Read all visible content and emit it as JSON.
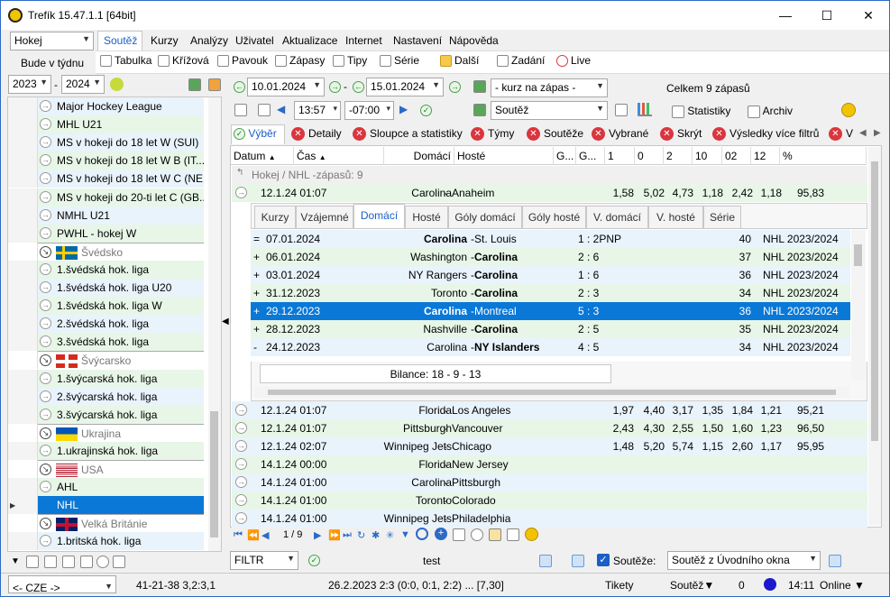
{
  "window": {
    "title": "Trefík 15.47.1.1 [64bit]"
  },
  "sport_select": "Hokej",
  "menu": [
    "Soutěž",
    "Kurzy",
    "Analýzy",
    "Uživatel",
    "Aktualizace",
    "Internet",
    "Nastavení",
    "Nápověda"
  ],
  "week_label": "Bude v týdnu",
  "toolbar": [
    "Tabulka",
    "Křížová",
    "Pavouk",
    "Zápasy",
    "Tipy",
    "Série",
    "Další",
    "Zadání",
    "Live"
  ],
  "year_from": "2023",
  "year_to": "2024",
  "date_from": "10.01.2024",
  "date_to": "15.01.2024",
  "time_from": "13:57",
  "time_to": "-07:00",
  "odds_select": "- kurz na zápas -",
  "competition_select": "Soutěž",
  "total_label": "Celkem 9 zápasů",
  "stats_label": "Statistiky",
  "archive_label": "Archiv",
  "tabs2": [
    "Výběr",
    "Detaily",
    "Sloupce a statistiky",
    "Týmy",
    "Soutěže",
    "Vybrané",
    "Skrýt",
    "Výsledky více filtrů",
    "V"
  ],
  "left_list": [
    {
      "label": "Major Hockey League",
      "type": "league"
    },
    {
      "label": "MHL U21",
      "type": "league"
    },
    {
      "label": "MS v hokeji do 18 let W (SUI)",
      "type": "league"
    },
    {
      "label": "MS v hokeji do 18 let W B (IT...",
      "type": "league"
    },
    {
      "label": "MS v hokeji do 18 let W C (NE...",
      "type": "league"
    },
    {
      "label": "MS v hokeji do 20-ti let C (GB...",
      "type": "league"
    },
    {
      "label": "NMHL U21",
      "type": "league"
    },
    {
      "label": "PWHL - hokej W",
      "type": "league"
    },
    {
      "label": "Švédsko",
      "type": "country",
      "flag": "se"
    },
    {
      "label": "1.švédská hok. liga",
      "type": "league"
    },
    {
      "label": "1.švédská hok. liga U20",
      "type": "league"
    },
    {
      "label": "1.švédská hok. liga W",
      "type": "league"
    },
    {
      "label": "2.švédská hok. liga",
      "type": "league"
    },
    {
      "label": "3.švédská hok. liga",
      "type": "league"
    },
    {
      "label": "Švýcarsko",
      "type": "country",
      "flag": "ch"
    },
    {
      "label": "1.švýcarská hok. liga",
      "type": "league"
    },
    {
      "label": "2.švýcarská hok. liga",
      "type": "league"
    },
    {
      "label": "3.švýcarská hok. liga",
      "type": "league"
    },
    {
      "label": "Ukrajina",
      "type": "country",
      "flag": "ua"
    },
    {
      "label": "1.ukrajinská hok. liga",
      "type": "league"
    },
    {
      "label": "USA",
      "type": "country",
      "flag": "us"
    },
    {
      "label": "AHL",
      "type": "league"
    },
    {
      "label": "NHL",
      "type": "selected"
    },
    {
      "label": "Velká Británie",
      "type": "country",
      "flag": "gb"
    },
    {
      "label": "1.britská hok. liga",
      "type": "league"
    }
  ],
  "grid_headers": [
    "Datum",
    "Čas",
    "Domácí",
    "Hosté",
    "G...",
    "G...",
    "1",
    "0",
    "2",
    "10",
    "02",
    "12",
    "%"
  ],
  "group_label": "Hokej / NHL -zápasů: 9",
  "matches_top": [
    {
      "date": "12.1.24 01:07",
      "home": "Carolina",
      "away": "Anaheim",
      "o1": "1,58",
      "o0": "5,02",
      "o2": "4,73",
      "o10": "1,18",
      "o02": "2,42",
      "o12": "1,18",
      "pct": "95,83"
    }
  ],
  "subtabs": [
    "Kurzy",
    "Vzájemné",
    "Domácí",
    "Hosté",
    "Góly domácí",
    "Góly hosté",
    "V. domácí",
    "V. hosté",
    "Série"
  ],
  "subrows": [
    {
      "mark": "=",
      "date": "07.01.2024",
      "home": "Carolina",
      "away": "St. Louis",
      "score": "1 : 2PNP",
      "n": "40",
      "comp": "NHL 2023/2024",
      "bold": "home"
    },
    {
      "mark": "+",
      "date": "06.01.2024",
      "home": "Washington",
      "away": "Carolina",
      "score": "2 : 6",
      "n": "37",
      "comp": "NHL 2023/2024",
      "bold": "away"
    },
    {
      "mark": "+",
      "date": "03.01.2024",
      "home": "NY Rangers",
      "away": "Carolina",
      "score": "1 : 6",
      "n": "36",
      "comp": "NHL 2023/2024",
      "bold": "away"
    },
    {
      "mark": "+",
      "date": "31.12.2023",
      "home": "Toronto",
      "away": "Carolina",
      "score": "2 : 3",
      "n": "34",
      "comp": "NHL 2023/2024",
      "bold": "away"
    },
    {
      "mark": "+",
      "date": "29.12.2023",
      "home": "Carolina",
      "away": "Montreal",
      "score": "5 : 3",
      "n": "36",
      "comp": "NHL 2023/2024",
      "bold": "home",
      "selected": true
    },
    {
      "mark": "+",
      "date": "28.12.2023",
      "home": "Nashville",
      "away": "Carolina",
      "score": "2 : 5",
      "n": "35",
      "comp": "NHL 2023/2024",
      "bold": "away"
    },
    {
      "mark": "-",
      "date": "24.12.2023",
      "home": "Carolina",
      "away": "NY Islanders",
      "score": "4 : 5",
      "n": "34",
      "comp": "NHL 2023/2024",
      "bold": "away"
    }
  ],
  "balance": "Bilance: 18 - 9 - 13",
  "matches": [
    {
      "date": "12.1.24 01:07",
      "home": "Florida",
      "away": "Los Angeles",
      "o1": "1,97",
      "o0": "4,40",
      "o2": "3,17",
      "o10": "1,35",
      "o02": "1,84",
      "o12": "1,21",
      "pct": "95,21"
    },
    {
      "date": "12.1.24 01:07",
      "home": "Pittsburgh",
      "away": "Vancouver",
      "o1": "2,43",
      "o0": "4,30",
      "o2": "2,55",
      "o10": "1,50",
      "o02": "1,60",
      "o12": "1,23",
      "pct": "96,50"
    },
    {
      "date": "12.1.24 02:07",
      "home": "Winnipeg Jets",
      "away": "Chicago",
      "o1": "1,48",
      "o0": "5,20",
      "o2": "5,74",
      "o10": "1,15",
      "o02": "2,60",
      "o12": "1,17",
      "pct": "95,95"
    },
    {
      "date": "14.1.24 00:00",
      "home": "Florida",
      "away": "New Jersey",
      "o1": "",
      "o0": "",
      "o2": "",
      "o10": "",
      "o02": "",
      "o12": "",
      "pct": ""
    },
    {
      "date": "14.1.24 01:00",
      "home": "Carolina",
      "away": "Pittsburgh",
      "o1": "",
      "o0": "",
      "o2": "",
      "o10": "",
      "o02": "",
      "o12": "",
      "pct": ""
    },
    {
      "date": "14.1.24 01:00",
      "home": "Toronto",
      "away": "Colorado",
      "o1": "",
      "o0": "",
      "o2": "",
      "o10": "",
      "o02": "",
      "o12": "",
      "pct": ""
    },
    {
      "date": "14.1.24 01:00",
      "home": "Winnipeg Jets",
      "away": "Philadelphia",
      "o1": "",
      "o0": "",
      "o2": "",
      "o10": "",
      "o02": "",
      "o12": "",
      "pct": ""
    }
  ],
  "pager": "1 / 9",
  "filter_select": "FILTR",
  "filter_text": "test",
  "souteze_label": "Soutěže:",
  "souteze_select": "Soutěž z Úvodního okna",
  "status": {
    "lang": "<- CZE ->",
    "record": "41-21-38  3,2:3,1",
    "last": "26.2.2023 2:3 (0:0, 0:1, 2:2) ... [7,30]",
    "tickets": "Tikety",
    "soutez": "Soutěž▼",
    "count": "0",
    "time": "14:11",
    "online": "Online ▼"
  }
}
